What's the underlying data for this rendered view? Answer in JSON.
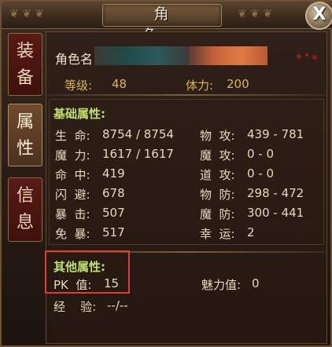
{
  "window": {
    "title": "角 色",
    "close_label": "X"
  },
  "tabs": [
    {
      "char1": "装",
      "char2": "备"
    },
    {
      "char1": "属",
      "char2": "性"
    },
    {
      "char1": "信",
      "char2": "息"
    }
  ],
  "header": {
    "name_label": "角色名",
    "level_label": "等级:",
    "level_value": "48",
    "stamina_label": "体力:",
    "stamina_value": "200"
  },
  "basic": {
    "title": "基础属性:",
    "left": [
      {
        "label": "生  命:",
        "value": "8754 / 8754"
      },
      {
        "label": "魔  力:",
        "value": "1617 / 1617"
      },
      {
        "label": "命  中:",
        "value": "419"
      },
      {
        "label": "闪  避:",
        "value": "678"
      },
      {
        "label": "暴  击:",
        "value": "507"
      },
      {
        "label": "免  暴:",
        "value": "517"
      }
    ],
    "right": [
      {
        "label": "物  攻:",
        "value": "439 - 781"
      },
      {
        "label": "魔  攻:",
        "value": "0 - 0"
      },
      {
        "label": "道  攻:",
        "value": "0 - 0"
      },
      {
        "label": "物  防:",
        "value": "298 - 472"
      },
      {
        "label": "魔  防:",
        "value": "300 - 441"
      },
      {
        "label": "幸  运:",
        "value": "2"
      }
    ]
  },
  "other": {
    "title": "其他属性:",
    "pk_label": "PK  值:",
    "pk_value": "15",
    "charm_label": "魅力值:",
    "charm_value": "0",
    "exp_label": "经    验:",
    "exp_value": "--/--"
  },
  "colors": {
    "highlight": "#e23c35",
    "section_title": "#bfe06a",
    "label_gold": "#d9b64a"
  }
}
